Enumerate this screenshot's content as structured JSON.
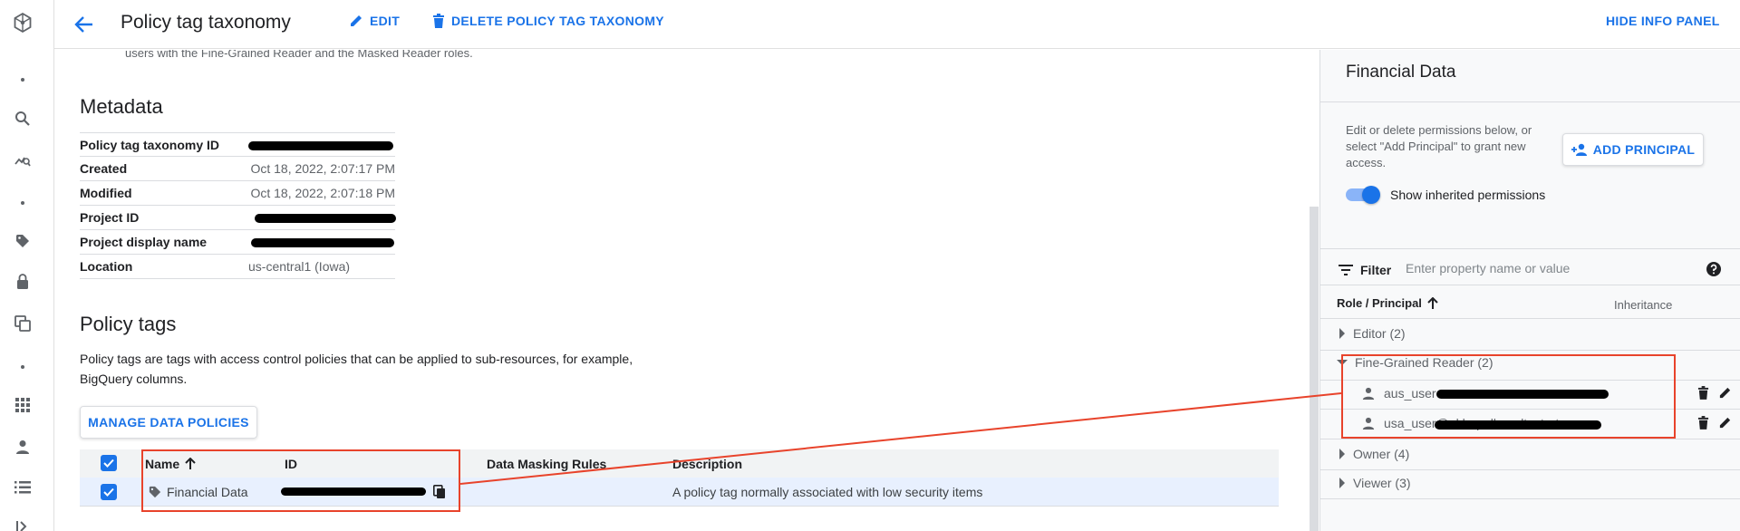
{
  "header": {
    "title": "Policy tag taxonomy",
    "edit_label": "EDIT",
    "delete_label": "DELETE POLICY TAG TAXONOMY",
    "hide_panel_label": "HIDE INFO PANEL"
  },
  "main": {
    "cut_text": "users with the Fine-Grained Reader and the Masked Reader roles.",
    "metadata_heading": "Metadata",
    "metadata": [
      {
        "key": "Policy tag taxonomy ID",
        "value": "",
        "redacted": true
      },
      {
        "key": "Created",
        "value": "Oct 18, 2022, 2:07:17 PM"
      },
      {
        "key": "Modified",
        "value": "Oct 18, 2022, 2:07:18 PM"
      },
      {
        "key": "Project ID",
        "value": "",
        "redacted": true
      },
      {
        "key": "Project display name",
        "value": "",
        "redacted": true
      },
      {
        "key": "Location",
        "value": "us-central1 (Iowa)"
      }
    ],
    "policy_tags_heading": "Policy tags",
    "policy_tags_desc": "Policy tags are tags with access control policies that can be applied to sub-resources, for example, BigQuery columns.",
    "manage_label": "MANAGE DATA POLICIES",
    "table": {
      "columns": [
        "Name",
        "ID",
        "Data Masking Rules",
        "Description"
      ],
      "rows": [
        {
          "name": "Financial Data",
          "id": "",
          "masking": "",
          "description": "A policy tag normally associated with low security items"
        }
      ]
    }
  },
  "panel": {
    "title": "Financial Data",
    "desc": "Edit or delete permissions below, or select \"Add Principal\" to grant new access.",
    "add_principal_label": "ADD PRINCIPAL",
    "toggle_label": "Show inherited permissions",
    "toggle_on": true,
    "filter_label": "Filter",
    "filter_placeholder": "Enter property name or value",
    "col_role": "Role / Principal",
    "col_inheritance": "Inheritance",
    "groups": [
      {
        "label": "Editor (2)",
        "expanded": false
      },
      {
        "label": "Fine-Grained Reader (2)",
        "expanded": true,
        "members": [
          "aus_user",
          "usa_user@akhapolkar.altostrat.com"
        ]
      },
      {
        "label": "Owner (4)",
        "expanded": false
      },
      {
        "label": "Viewer (3)",
        "expanded": false
      }
    ]
  },
  "colors": {
    "accent": "#1a73e8",
    "highlight": "#e8432b"
  }
}
